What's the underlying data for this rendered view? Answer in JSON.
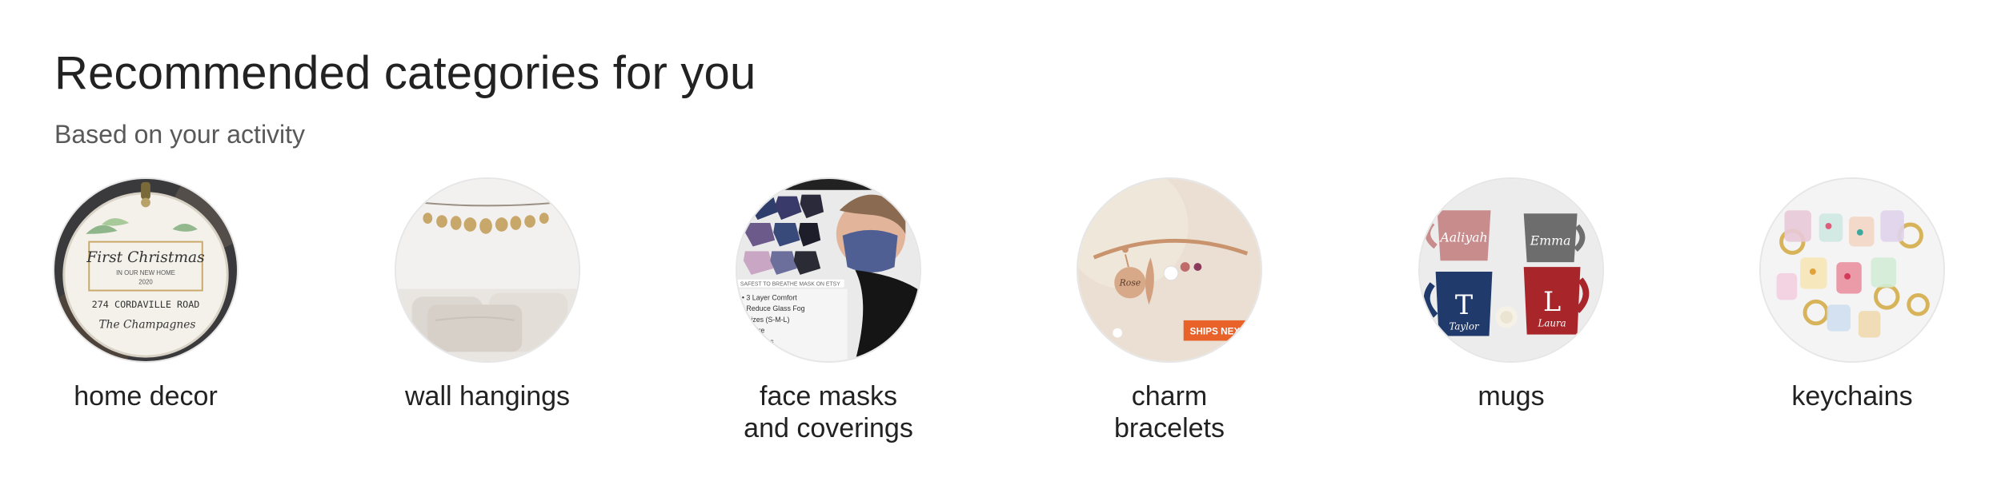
{
  "header": {
    "title": "Recommended categories for you",
    "subtitle": "Based on your activity"
  },
  "categories": [
    {
      "label_line1": "home decor",
      "label_line2": "",
      "image_icon": "ornament-image-icon"
    },
    {
      "label_line1": "wall hangings",
      "label_line2": "",
      "image_icon": "wall-garland-image-icon"
    },
    {
      "label_line1": "face masks",
      "label_line2": "and coverings",
      "image_icon": "face-mask-image-icon"
    },
    {
      "label_line1": "charm",
      "label_line2": "bracelets",
      "image_icon": "charm-bracelet-image-icon"
    },
    {
      "label_line1": "mugs",
      "label_line2": "",
      "image_icon": "mugs-image-icon"
    },
    {
      "label_line1": "keychains",
      "label_line2": "",
      "image_icon": "keychains-image-icon"
    }
  ],
  "image_text": {
    "ornament_line1": "First Christmas",
    "ornament_line2": "IN OUR NEW HOME",
    "ornament_year": "2020",
    "ornament_address": "274 CORDAVILLE ROAD",
    "ornament_name": "The Champagnes",
    "bracelet_charm": "Rose",
    "bracelet_badge": "SHIPS NEXT",
    "mask_banner": "SAFEST TO BREATHE MASK ON ETSY",
    "mask_bullets": [
      "• 3 Layer Comfort",
      "• Reduce Glass Fog",
      "• Sizes (S-M-L)",
      "  ire wire",
      "  ble Straps",
      "  ption"
    ],
    "mug_names": [
      "Aaliyah",
      "Emma",
      "Taylor",
      "Laura"
    ]
  }
}
